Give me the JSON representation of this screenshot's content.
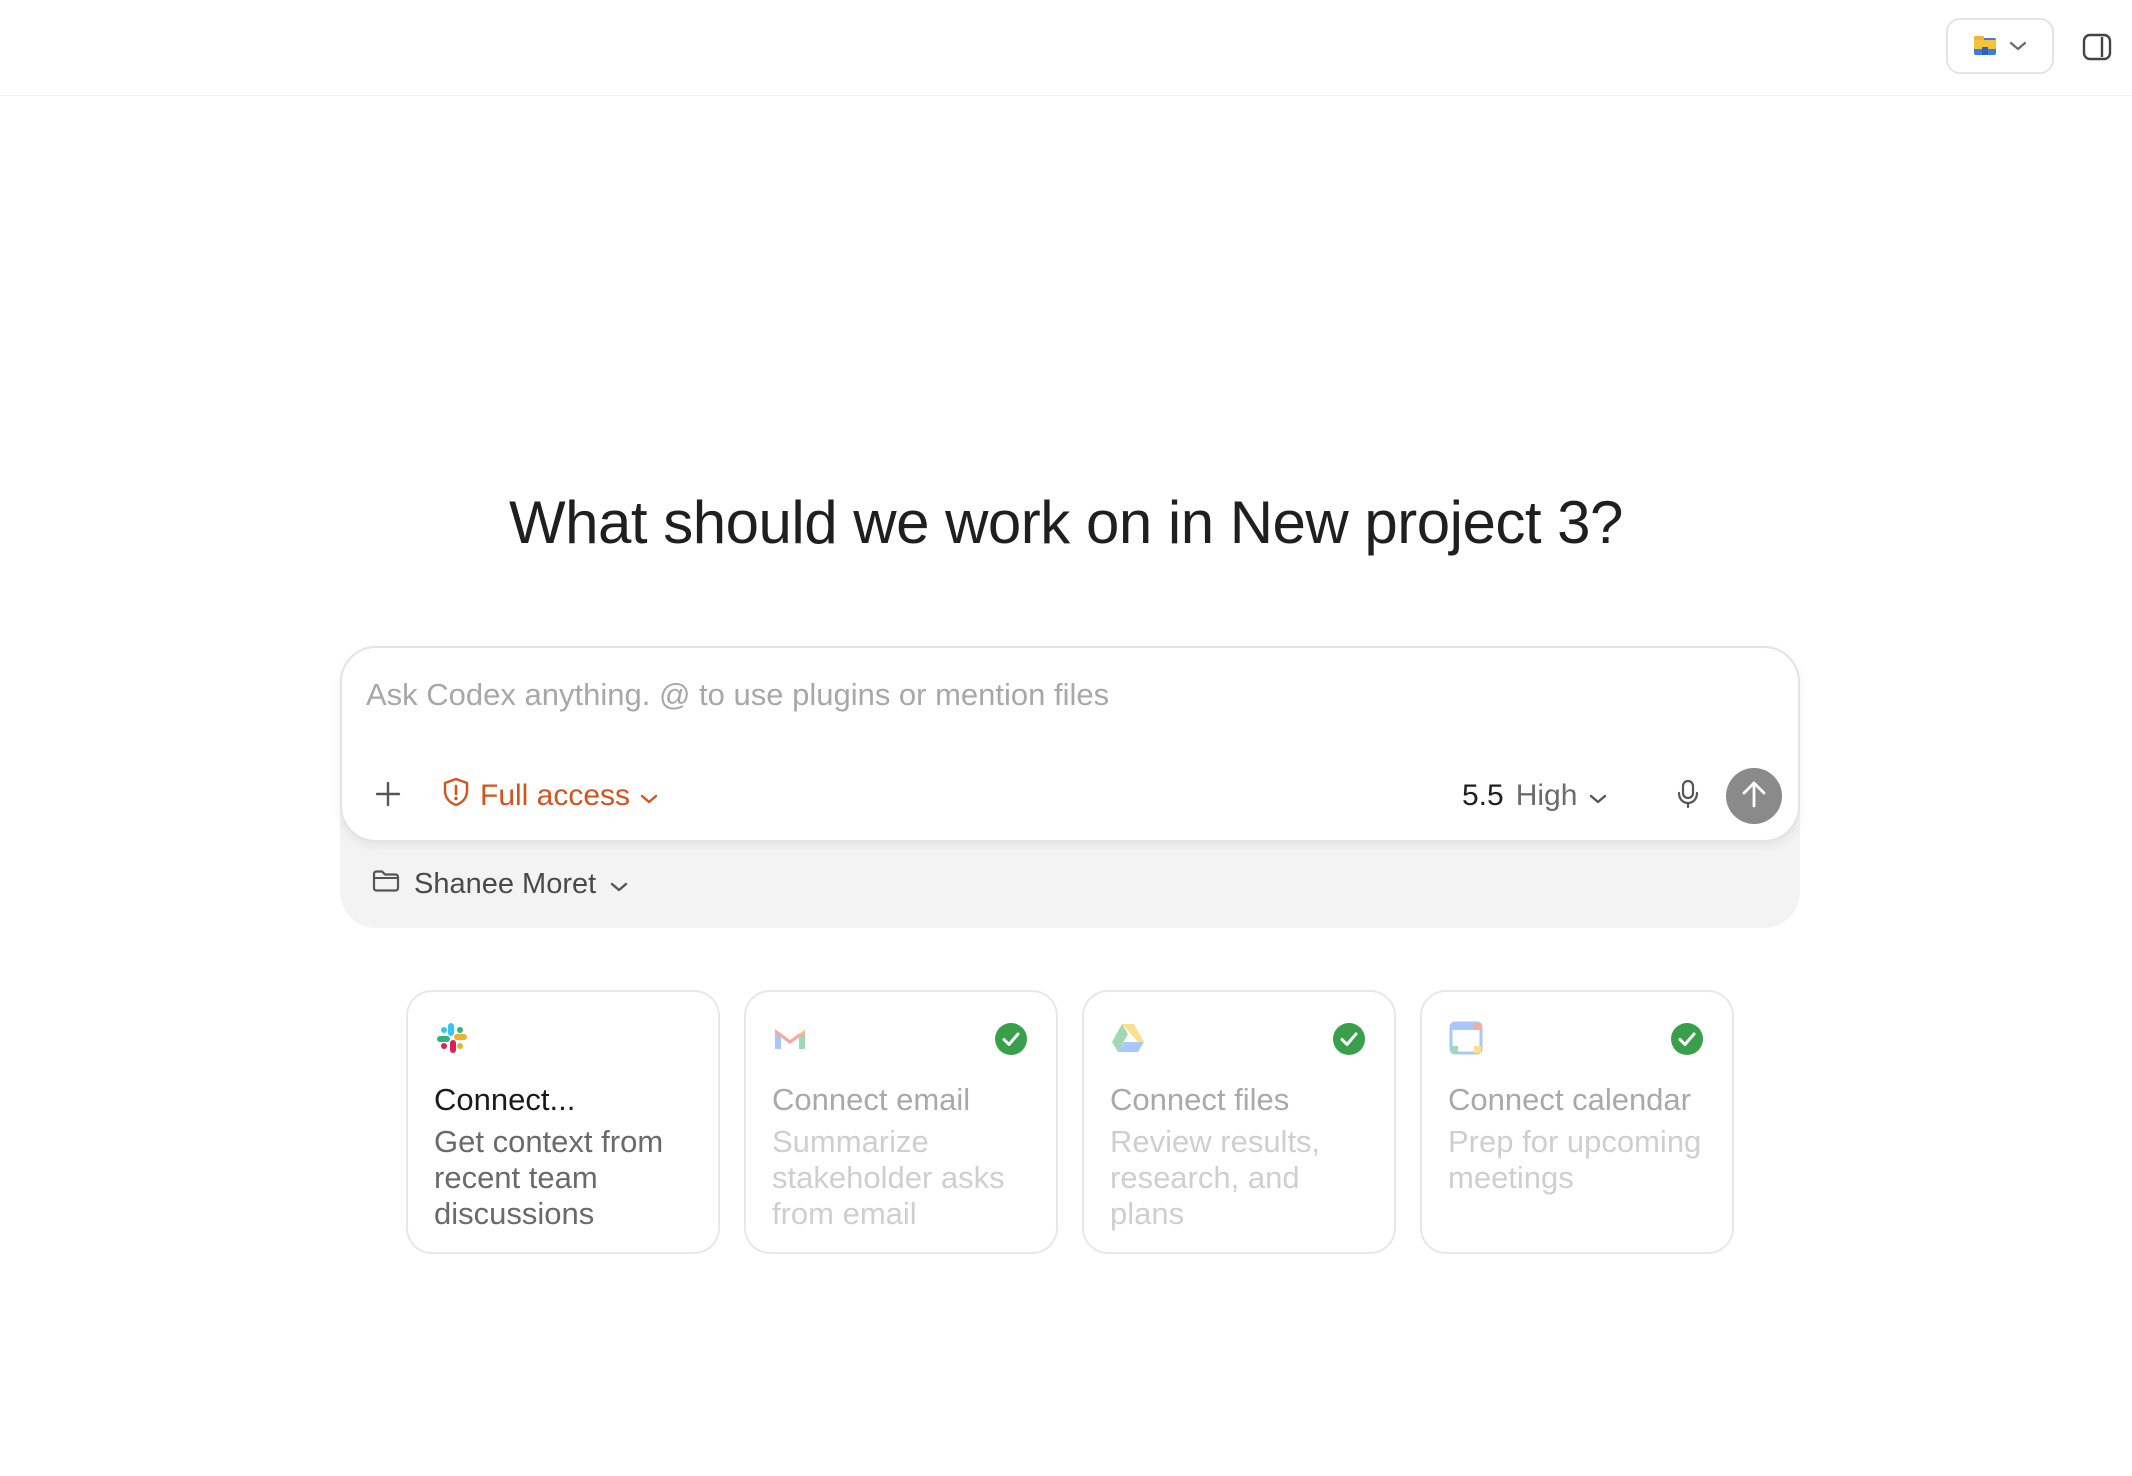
{
  "header": {
    "open_in_icon": "folder-app-icon",
    "sidebar_toggle_icon": "sidebar-toggle-icon"
  },
  "main": {
    "headline": "What should we work on in New project 3?"
  },
  "composer": {
    "placeholder": "Ask Codex anything. @ to use plugins or mention files",
    "value": "",
    "access_label": "Full access",
    "access_color": "#d2541e",
    "model_version": "5.5",
    "model_effort": "High",
    "project_label": "Shanee Moret"
  },
  "cards": [
    {
      "icon": "slack-icon",
      "title": "Connect...",
      "description": "Get context from recent team discussions",
      "connected": false
    },
    {
      "icon": "gmail-icon",
      "title": "Connect email",
      "description": "Summarize stakeholder asks from email",
      "connected": true
    },
    {
      "icon": "google-drive-icon",
      "title": "Connect files",
      "description": "Review results, research, and plans",
      "connected": true
    },
    {
      "icon": "google-calendar-icon",
      "title": "Connect calendar",
      "description": "Prep for upcoming meetings",
      "connected": true
    }
  ],
  "colors": {
    "check_green": "#3a9f4b",
    "send_button": "#8a8a8a"
  }
}
